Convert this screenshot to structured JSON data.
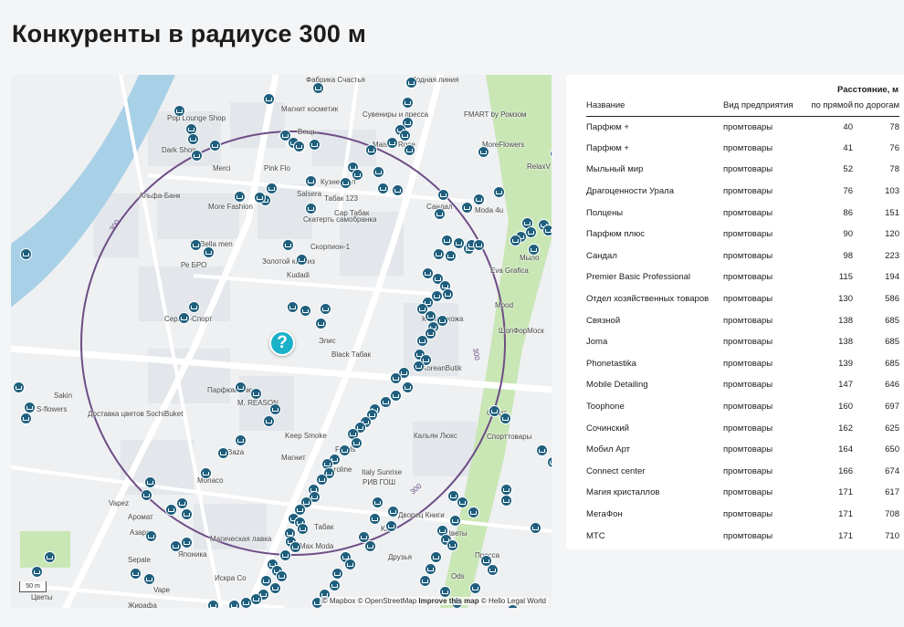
{
  "page": {
    "title": "Конкуренты в радиусе 300 м"
  },
  "map": {
    "center_marker": "?",
    "radius_label": "300",
    "scale_label": "50 m",
    "attribution": {
      "mapbox": "© Mapbox",
      "osm": "© OpenStreetMap",
      "improve": "Improve this map",
      "hello": "© Hello Legal World"
    },
    "icons": {
      "shop": "shopping-cart-icon",
      "center": "question-icon"
    },
    "colors": {
      "marker": "#1f5f7d",
      "center": "#1bb1c9",
      "radius": "#6e4d86",
      "river": "#a8d0e6",
      "park": "#c9e6b5"
    },
    "labels": [
      "Фабрика Счастья",
      "Модная линия",
      "Магнит косметик",
      "Сувениры и пресса",
      "FMART by Ромзом",
      "Pop Lounge Shop",
      "Вещь",
      "Maison Rose",
      "MoreFlowers",
      "Dark Shop",
      "Merci",
      "Pink Flo",
      "RelaxV",
      "Альфа-Банк",
      "Кузнец тут",
      "Табак 123",
      "Сар Табак",
      "Сандал",
      "Moda 4u",
      "Salsera",
      "More Fashion",
      "Скатерть самобранка",
      "Скорпион-1",
      "Мыло",
      "Eva Grafica",
      "La Bella men",
      "Ре БРО",
      "Золотой каприз",
      "Kudadi",
      "Mood",
      "Сервис-Спорт",
      "Кожа и кожа",
      "ШопФорМоск",
      "Элис",
      "Black Табак",
      "KoreanButik",
      "Парфюм плюс",
      "M. REASON",
      "Доставка цветов SochiBuket",
      "S-flowers",
      "Sakin",
      "Старт",
      "Спорттовары",
      "Keep Smoke",
      "Кальян Люкс",
      "Baza",
      "Monaco",
      "Магнит",
      "Funds",
      "Euroline",
      "Italy Sunrise",
      "РИВ ГОШ",
      "Vapez",
      "Аромат",
      "Табак",
      "Дворец Книги",
      "Kirti",
      "Азаро",
      "Цветы",
      "Пресса",
      "Sepale",
      "Японика",
      "Магическая лавка",
      "Max Moda",
      "Друзья",
      "Искра Со",
      "Ods",
      "Цветы",
      "Жирафа",
      "Vape"
    ]
  },
  "table": {
    "distance_header": "Расстояние, м",
    "columns": {
      "name": "Название",
      "type": "Вид предприятия",
      "straight": "по прямой",
      "road": "по дорогам"
    },
    "rows": [
      {
        "name": "Парфюм +",
        "type": "промтовары",
        "straight": "40",
        "road": "78"
      },
      {
        "name": "Парфюм +",
        "type": "промтовары",
        "straight": "41",
        "road": "76"
      },
      {
        "name": "Мыльный мир",
        "type": "промтовары",
        "straight": "52",
        "road": "78"
      },
      {
        "name": "Драгоценности Урала",
        "type": "промтовары",
        "straight": "76",
        "road": "103"
      },
      {
        "name": "Полцены",
        "type": "промтовары",
        "straight": "86",
        "road": "151"
      },
      {
        "name": "Парфюм плюс",
        "type": "промтовары",
        "straight": "90",
        "road": "120"
      },
      {
        "name": "Сандал",
        "type": "промтовары",
        "straight": "98",
        "road": "223"
      },
      {
        "name": "Premier Basic Professional",
        "type": "промтовары",
        "straight": "115",
        "road": "194"
      },
      {
        "name": "Отдел хозяйственных товаров",
        "type": "промтовары",
        "straight": "130",
        "road": "586"
      },
      {
        "name": "Связной",
        "type": "промтовары",
        "straight": "138",
        "road": "685"
      },
      {
        "name": "Joma",
        "type": "промтовары",
        "straight": "138",
        "road": "685"
      },
      {
        "name": "Phonetastika",
        "type": "промтовары",
        "straight": "139",
        "road": "685"
      },
      {
        "name": "Mobile Detailing",
        "type": "промтовары",
        "straight": "147",
        "road": "646"
      },
      {
        "name": "Toophone",
        "type": "промтовары",
        "straight": "160",
        "road": "697"
      },
      {
        "name": "Сочинский",
        "type": "промтовары",
        "straight": "162",
        "road": "625"
      },
      {
        "name": "Мобил Арт",
        "type": "промтовары",
        "straight": "164",
        "road": "650"
      },
      {
        "name": "Connect center",
        "type": "промтовары",
        "straight": "166",
        "road": "674"
      },
      {
        "name": "Магия кристаллов",
        "type": "промтовары",
        "straight": "171",
        "road": "617"
      },
      {
        "name": "МегаФон",
        "type": "промтовары",
        "straight": "171",
        "road": "708"
      },
      {
        "name": "МТС",
        "type": "промтовары",
        "straight": "171",
        "road": "710"
      }
    ]
  },
  "chart_data": {
    "type": "table",
    "title": "",
    "columns": [
      "Название",
      "Вид предприятия",
      "по прямой",
      "по дорогам"
    ],
    "rows": [
      [
        "Парфюм +",
        "промтовары",
        40,
        78
      ],
      [
        "Парфюм +",
        "промтовары",
        41,
        76
      ],
      [
        "Мыльный мир",
        "промтовары",
        52,
        78
      ],
      [
        "Драгоценности Урала",
        "промтовары",
        76,
        103
      ],
      [
        "Полцены",
        "промтовары",
        86,
        151
      ],
      [
        "Парфюм плюс",
        "промтовары",
        90,
        120
      ],
      [
        "Сандал",
        "промтовары",
        98,
        223
      ],
      [
        "Premier Basic Professional",
        "промтовары",
        115,
        194
      ],
      [
        "Отдел хозяйственных товаров",
        "промтовары",
        130,
        586
      ],
      [
        "Связной",
        "промтовары",
        138,
        685
      ],
      [
        "Joma",
        "промтовары",
        138,
        685
      ],
      [
        "Phonetastika",
        "промтовары",
        139,
        685
      ],
      [
        "Mobile Detailing",
        "промтовары",
        147,
        646
      ],
      [
        "Toophone",
        "промтовары",
        160,
        697
      ],
      [
        "Сочинский",
        "промтовары",
        162,
        625
      ],
      [
        "Мобил Арт",
        "промтовары",
        164,
        650
      ],
      [
        "Connect center",
        "промтовары",
        166,
        674
      ],
      [
        "Магия кристаллов",
        "промтовары",
        171,
        617
      ],
      [
        "МегаФон",
        "промтовары",
        171,
        708
      ],
      [
        "МТС",
        "промтовары",
        171,
        710
      ]
    ]
  }
}
